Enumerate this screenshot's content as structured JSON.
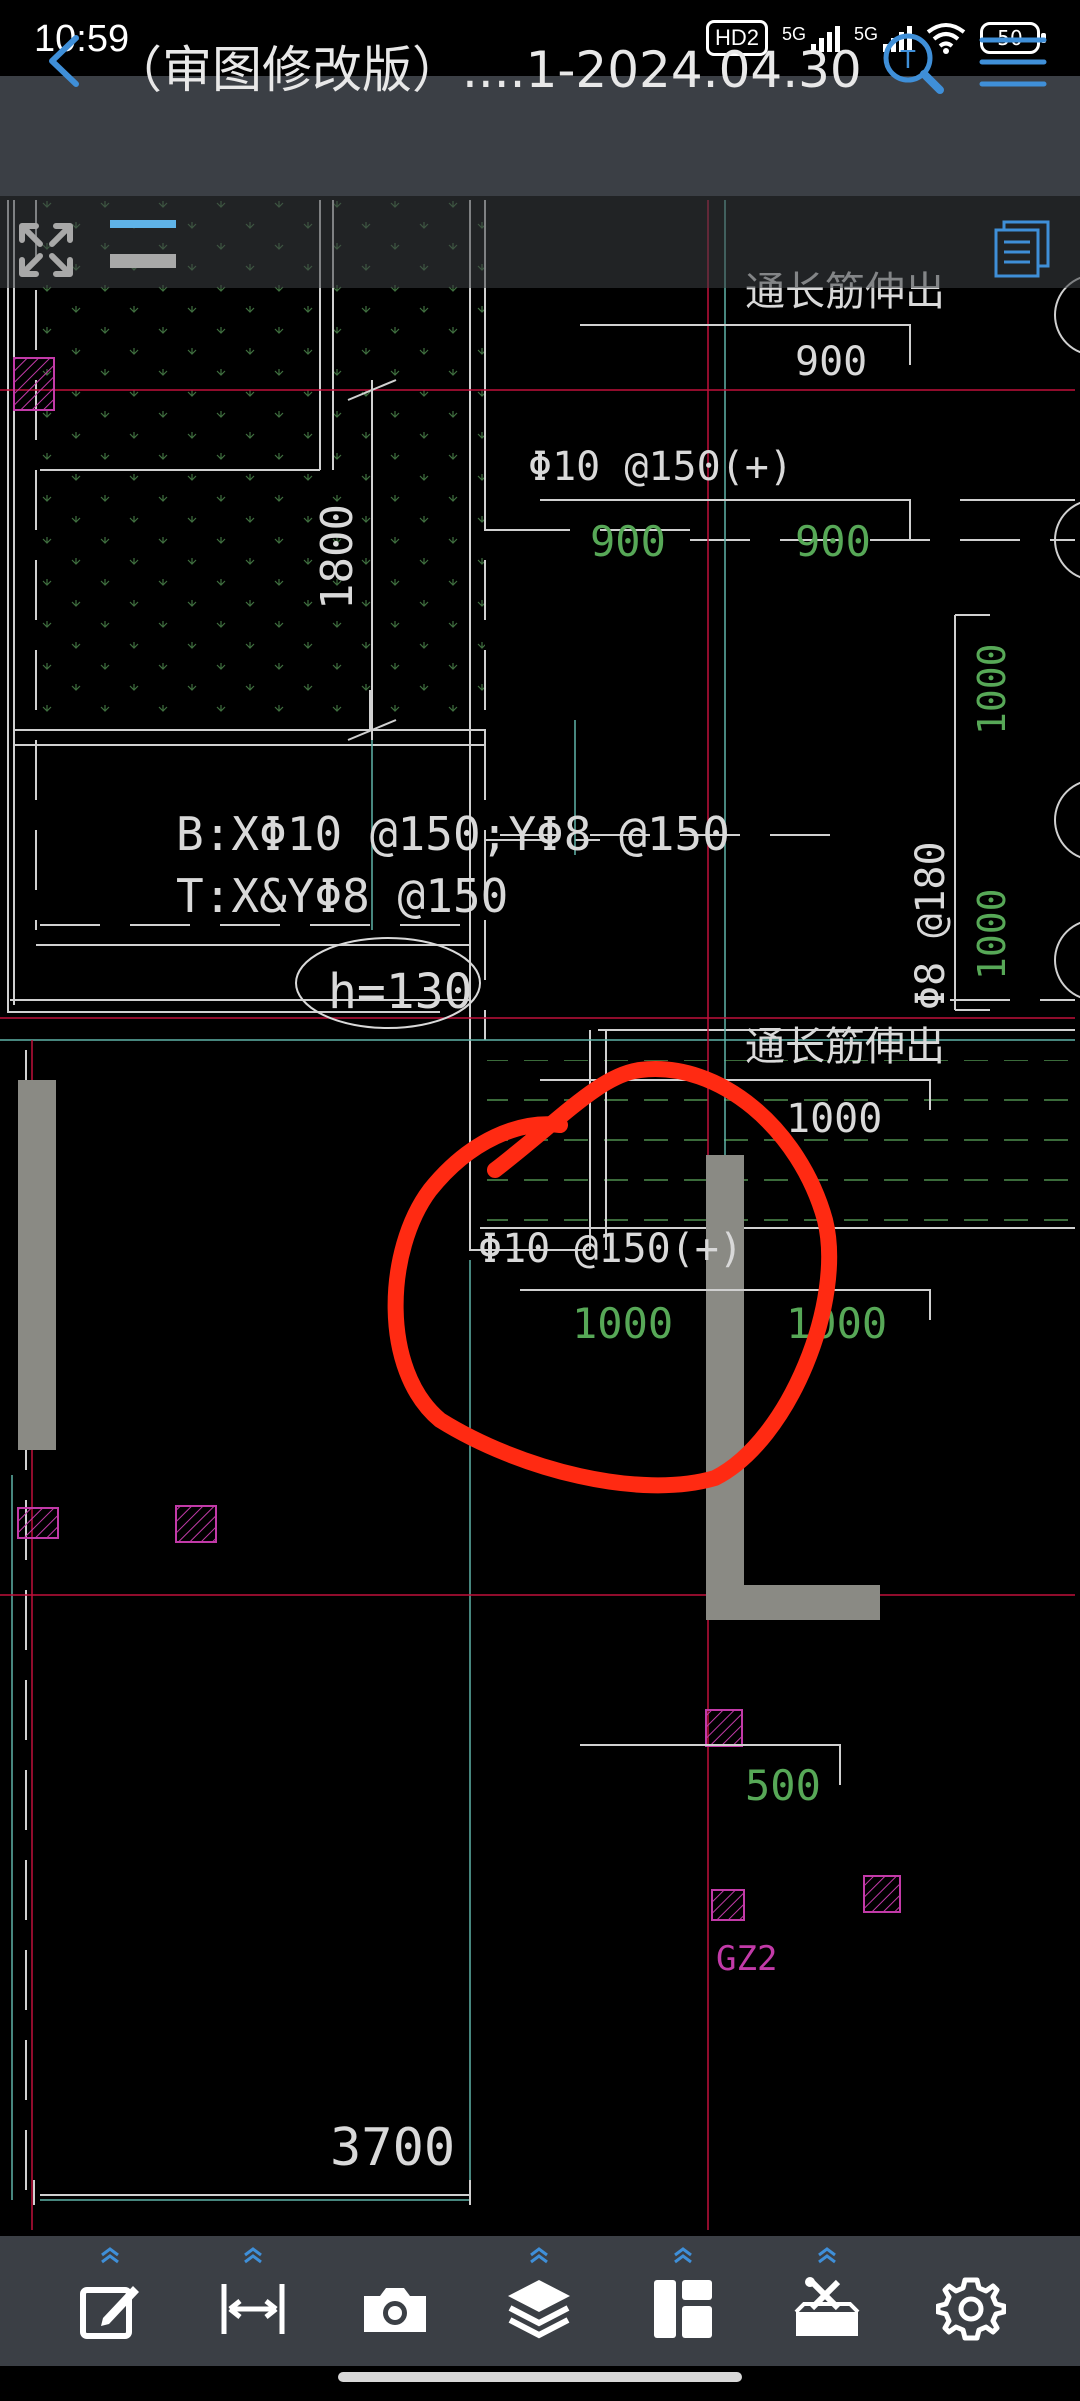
{
  "status_bar": {
    "time": "10:59",
    "hd_badge": "HD2",
    "network_1": "5G",
    "network_2": "5G",
    "battery": "50"
  },
  "app_bar": {
    "title": "（审图修改版）....1-2024.04.30",
    "back_icon": "chevron-left-icon",
    "search_icon": "text-search-icon",
    "menu_icon": "hamburger-icon"
  },
  "drawing": {
    "labels": {
      "through_rebar_top": "通长筋伸出",
      "dim_900_top": "900",
      "rebar_top": "Φ10 @150(+)",
      "dim_900_left": "900",
      "dim_900_right": "900",
      "dim_1800": "1800",
      "slab_bottom": "B:XΦ10 @150;YΦ8 @150",
      "slab_top": "T:X&YΦ8 @150",
      "thickness": "h=130",
      "dim_1000_v1": "1000",
      "dim_1000_v2": "1000",
      "rebar_vertical": "Φ8 @180",
      "through_rebar_mid": "通长筋伸出",
      "dim_1000_mid": "1000",
      "rebar_mid": "Φ10 @150(+)",
      "dim_1000_left": "1000",
      "dim_1000_right": "1000",
      "dim_500": "500",
      "column_tag": "GZ2",
      "dim_3700": "3700"
    },
    "colors": {
      "white_text": "#d9d9d9",
      "green_text": "#57a857",
      "magenta": "#c23aa8",
      "cyan_line": "#5fb3a8",
      "red_line": "#c0103a",
      "markup_red": "#ff2a12",
      "wall_fill": "#8a8a84"
    }
  },
  "toolbar": {
    "accent": "#3f8fd8",
    "items": [
      {
        "icon": "edit-icon"
      },
      {
        "icon": "measure-icon"
      },
      {
        "icon": "camera-icon"
      },
      {
        "icon": "layers-icon"
      },
      {
        "icon": "layout-icon"
      },
      {
        "icon": "toolbox-icon"
      },
      {
        "icon": "settings-icon"
      }
    ]
  }
}
